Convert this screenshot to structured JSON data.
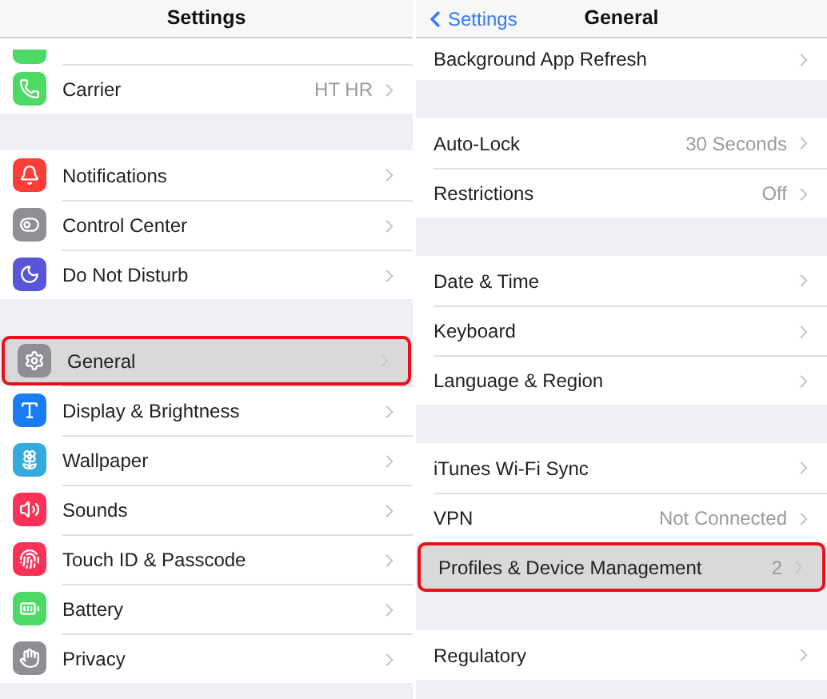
{
  "left": {
    "title": "Settings",
    "partial_row": {
      "color": "#4cd964"
    },
    "sections": [
      {
        "rows": [
          {
            "label": "Carrier",
            "value": "HT HR",
            "color": "#4cd964",
            "selected": false
          }
        ]
      },
      {
        "rows": [
          {
            "label": "Notifications",
            "color": "#fc3d39",
            "selected": false
          },
          {
            "label": "Control Center",
            "color": "#8e8e93",
            "selected": false
          },
          {
            "label": "Do Not Disturb",
            "color": "#5856d6",
            "selected": false
          }
        ]
      },
      {
        "rows": [
          {
            "label": "General",
            "color": "#8e8e93",
            "selected": true
          },
          {
            "label": "Display & Brightness",
            "color": "#1a7cf5",
            "selected": false
          },
          {
            "label": "Wallpaper",
            "color": "#35aadc",
            "selected": false
          },
          {
            "label": "Sounds",
            "color": "#fc3158",
            "selected": false
          },
          {
            "label": "Touch ID & Passcode",
            "color": "#fc3158",
            "selected": false
          },
          {
            "label": "Battery",
            "color": "#4cd964",
            "selected": false
          },
          {
            "label": "Privacy",
            "color": "#8e8e93",
            "selected": false
          }
        ]
      }
    ]
  },
  "right": {
    "back": "Settings",
    "title": "General",
    "sections": [
      {
        "rows": [
          {
            "label": "Background App Refresh",
            "selected": false
          }
        ]
      },
      {
        "rows": [
          {
            "label": "Auto-Lock",
            "value": "30 Seconds",
            "selected": false
          },
          {
            "label": "Restrictions",
            "value": "Off",
            "selected": false
          }
        ]
      },
      {
        "rows": [
          {
            "label": "Date & Time",
            "selected": false
          },
          {
            "label": "Keyboard",
            "selected": false
          },
          {
            "label": "Language & Region",
            "selected": false
          }
        ]
      },
      {
        "rows": [
          {
            "label": "iTunes Wi-Fi Sync",
            "selected": false
          },
          {
            "label": "VPN",
            "value": "Not Connected",
            "selected": false
          },
          {
            "label": "Profiles & Device Management",
            "value": "2",
            "selected": true
          }
        ]
      },
      {
        "rows": [
          {
            "label": "Regulatory",
            "selected": false
          }
        ]
      }
    ]
  }
}
